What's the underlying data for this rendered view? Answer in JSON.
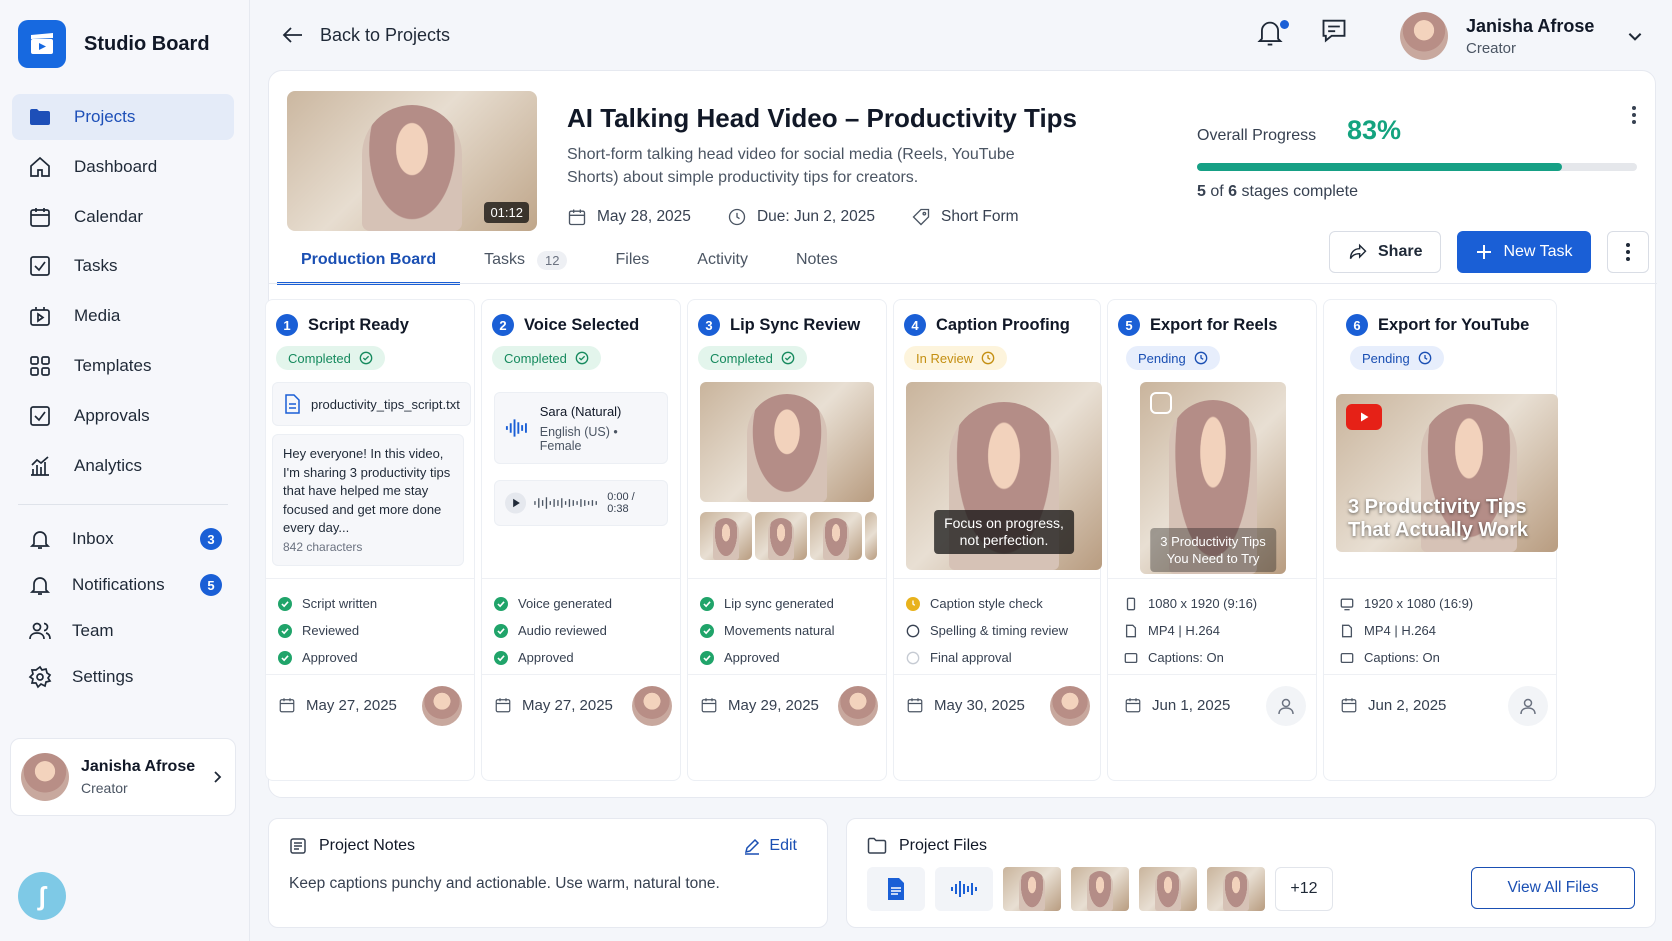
{
  "brand": {
    "name": "Studio Board"
  },
  "sidebar": {
    "items": [
      {
        "label": "Projects"
      },
      {
        "label": "Dashboard"
      },
      {
        "label": "Calendar"
      },
      {
        "label": "Tasks"
      },
      {
        "label": "Media"
      },
      {
        "label": "Templates"
      },
      {
        "label": "Approvals"
      },
      {
        "label": "Analytics"
      }
    ],
    "secondary": [
      {
        "label": "Inbox",
        "badge": "3"
      },
      {
        "label": "Notifications",
        "badge": "5"
      },
      {
        "label": "Team"
      },
      {
        "label": "Settings"
      }
    ],
    "user": {
      "name": "Janisha Afrose",
      "role": "Creator"
    }
  },
  "header": {
    "back_label": "Back to Projects",
    "user": {
      "name": "Janisha Afrose",
      "role": "Creator"
    }
  },
  "project": {
    "duration": "01:12",
    "title": "AI Talking Head Video – Productivity Tips",
    "description": "Short-form talking head video for social media (Reels, YouTube Shorts) about simple productivity tips for creators.",
    "created": "May 28, 2025",
    "due": "Due: Jun 2, 2025",
    "type": "Short Form",
    "progress_label": "Overall Progress",
    "progress_percent": "83%",
    "progress_value": 0.83,
    "stages_done": "5",
    "stages_total": "6",
    "stages_text": "stages complete"
  },
  "tabs": [
    {
      "label": "Production Board"
    },
    {
      "label": "Tasks",
      "count": "12"
    },
    {
      "label": "Files"
    },
    {
      "label": "Activity"
    },
    {
      "label": "Notes"
    }
  ],
  "actions": {
    "share": "Share",
    "new_task": "New Task"
  },
  "stages": [
    {
      "num": "1",
      "title": "Script Ready",
      "status": "Completed",
      "file": "productivity_tips_script.txt",
      "script": "Hey everyone! In this video, I'm sharing 3 productivity tips that have helped me stay focused and get more done every day...",
      "chars": "842 characters",
      "checklist": [
        "Script written",
        "Reviewed",
        "Approved"
      ],
      "date": "May 27, 2025"
    },
    {
      "num": "2",
      "title": "Voice Selected",
      "status": "Completed",
      "voice_name": "Sara (Natural)",
      "voice_desc": "English (US) • Female",
      "time": "0:00 / 0:38",
      "checklist": [
        "Voice generated",
        "Audio reviewed",
        "Approved"
      ],
      "date": "May 27, 2025"
    },
    {
      "num": "3",
      "title": "Lip Sync Review",
      "status": "Completed",
      "checklist": [
        "Lip sync generated",
        "Movements natural",
        "Approved"
      ],
      "date": "May 29, 2025"
    },
    {
      "num": "4",
      "title": "Caption Proofing",
      "status": "In Review",
      "caption_line1": "Focus on progress,",
      "caption_line2": "not perfection.",
      "checklist": [
        "Caption style check",
        "Spelling & timing review",
        "Final approval"
      ],
      "date": "May 30, 2025"
    },
    {
      "num": "5",
      "title": "Export for Reels",
      "status": "Pending",
      "overlay_line1": "3 Productivity Tips",
      "overlay_line2": "You Need to Try",
      "checklist": [
        "1080 x 1920 (9:16)",
        "MP4 | H.264",
        "Captions: On"
      ],
      "date": "Jun 1, 2025"
    },
    {
      "num": "6",
      "title": "Export for YouTube",
      "status": "Pending",
      "overlay_line1": "3 Productivity Tips",
      "overlay_line2": "That Actually Work",
      "checklist": [
        "1920 x 1080 (16:9)",
        "MP4 | H.264",
        "Captions: On"
      ],
      "date": "Jun 2, 2025"
    }
  ],
  "notes_panel": {
    "title": "Project Notes",
    "edit": "Edit",
    "text": "Keep captions punchy and actionable. Use warm, natural tone."
  },
  "files_panel": {
    "title": "Project Files",
    "more": "+12",
    "view_all": "View All Files"
  },
  "colors": {
    "accent": "#1a5fd6",
    "progress": "#16a085",
    "completed": "#168a5e",
    "in_review": "#c48f12"
  }
}
